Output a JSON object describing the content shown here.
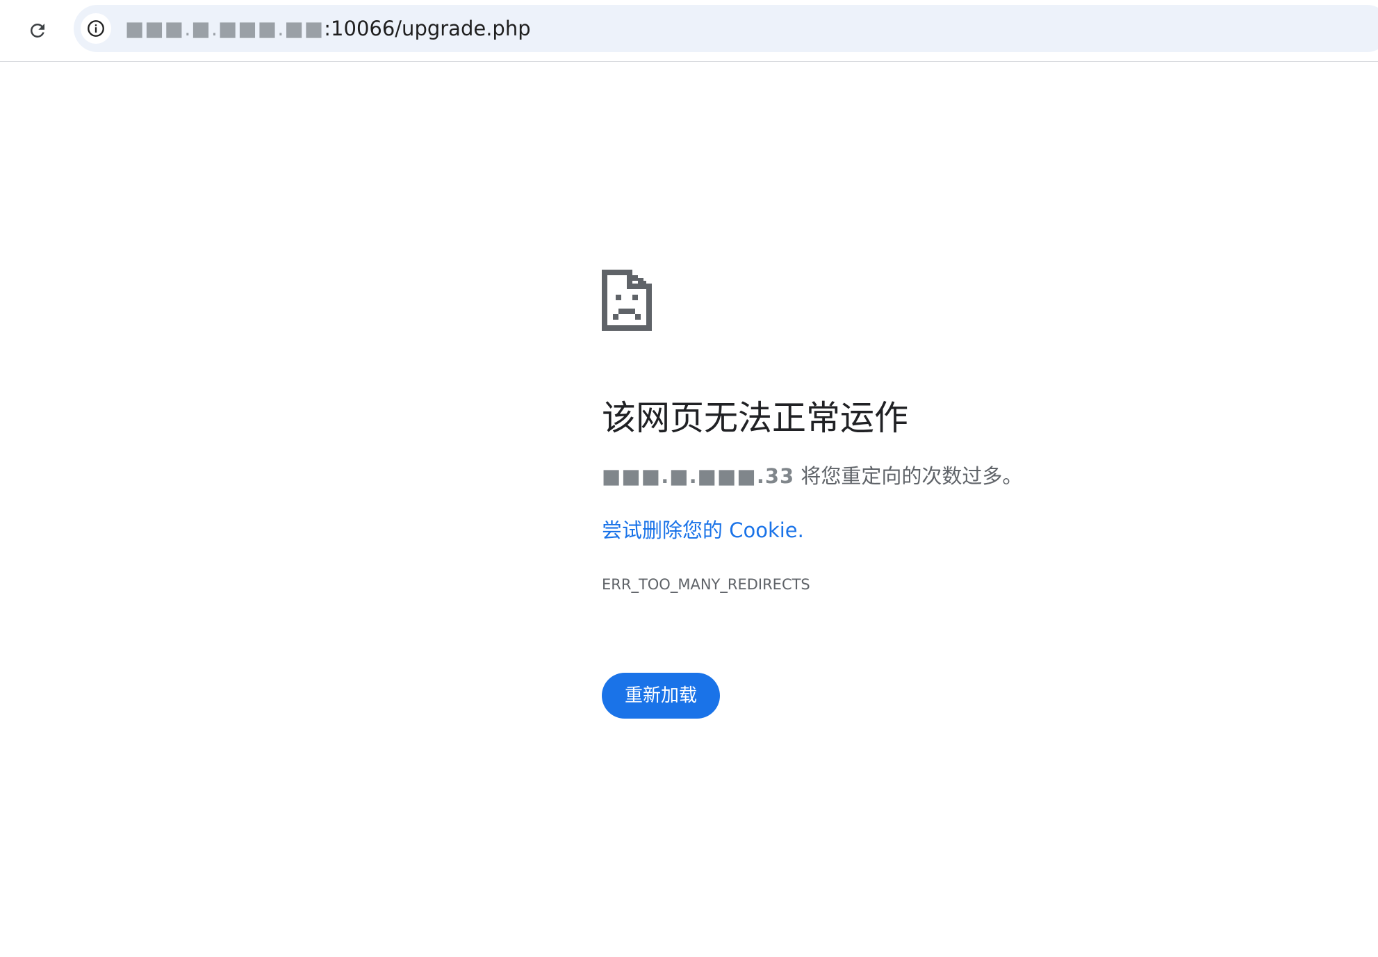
{
  "toolbar": {
    "url_redacted": "■■■.■.■■■.■■",
    "url_suffix": ":10066/upgrade.php"
  },
  "error": {
    "title": "该网页无法正常运作",
    "host_redacted": "■■■.■.■■■",
    "host_suffix": ".33",
    "message": " 将您重定向的次数过多。",
    "cookie_link": "尝试删除您的 Cookie.",
    "code": "ERR_TOO_MANY_REDIRECTS",
    "reload_label": "重新加载"
  },
  "colors": {
    "accent": "#1a73e8",
    "omnibox_bg": "#edf2fa",
    "title_text": "#202124",
    "secondary_text": "#5f6368"
  },
  "icons": {
    "reload": "reload-icon",
    "site_info": "info-icon",
    "sad_page": "sad-page-icon"
  }
}
